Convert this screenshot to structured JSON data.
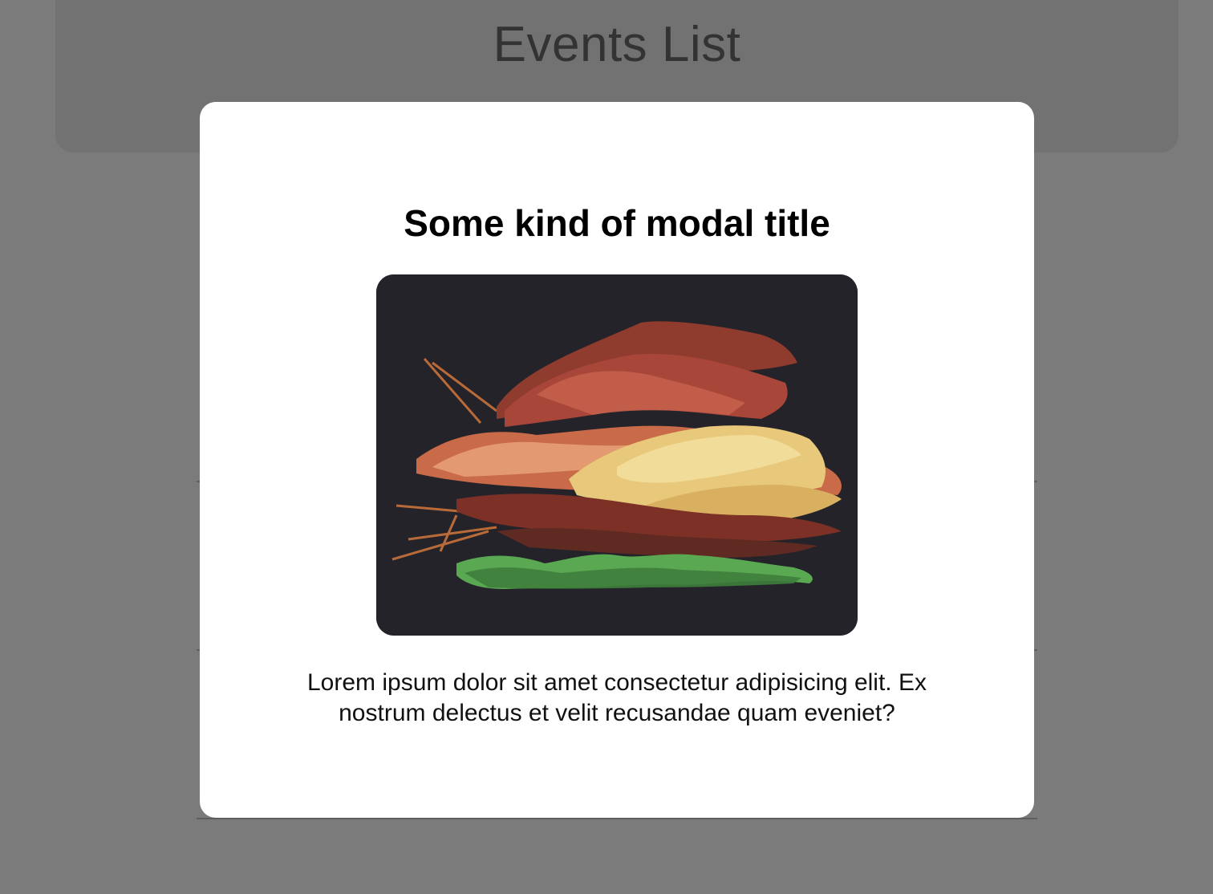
{
  "page": {
    "title": "Events List"
  },
  "modal": {
    "title": "Some kind of modal title",
    "image": {
      "description_icon": "autumn-leaves-image"
    },
    "body": "Lorem ipsum dolor sit amet consectetur adipisicing elit. Ex nostrum delectus et velit recusandae quam eveniet?"
  },
  "colors": {
    "backdrop": "#7b7b7b",
    "header_card": "#727272",
    "modal_background": "#ffffff",
    "image_background": "#24232a"
  }
}
